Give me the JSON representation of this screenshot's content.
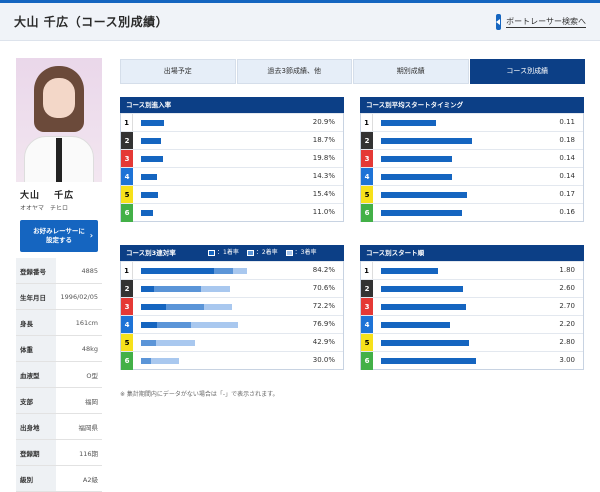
{
  "header": {
    "title": "大山 千広（コース別成績）",
    "back_link": "ボートレーサー検索へ"
  },
  "profile": {
    "name": "大山　 千広",
    "kana": "オオヤマ　チヒロ",
    "favorite_button": "お好みレーサーに\n設定する",
    "rows": [
      {
        "label": "登録番号",
        "value": "4885"
      },
      {
        "label": "生年月日",
        "value": "1996/02/05"
      },
      {
        "label": "身長",
        "value": "161cm"
      },
      {
        "label": "体重",
        "value": "48kg"
      },
      {
        "label": "血液型",
        "value": "O型"
      },
      {
        "label": "支部",
        "value": "福岡"
      },
      {
        "label": "出身地",
        "value": "福岡県"
      },
      {
        "label": "登録期",
        "value": "116期"
      },
      {
        "label": "級別",
        "value": "A2級"
      }
    ]
  },
  "tabs": [
    "出場予定",
    "過去3節成績、他",
    "期別成績",
    "コース別成績"
  ],
  "active_tab": 3,
  "colors": {
    "navy": "#0c3f86",
    "bar": "#1565c0",
    "bar2": "#5b95d8",
    "bar3": "#a9c8ef",
    "lane1_bg": "#ffffff",
    "lane1_fg": "#000000",
    "lane2_bg": "#333333",
    "lane2_fg": "#ffffff",
    "lane3_bg": "#e53935",
    "lane3_fg": "#ffffff",
    "lane4_bg": "#1e73d6",
    "lane4_fg": "#ffffff",
    "lane5_bg": "#f7e11a",
    "lane5_fg": "#000000",
    "lane6_bg": "#43b047",
    "lane6_fg": "#ffffff"
  },
  "panels": {
    "entry_rate": {
      "title": "コース別進入率",
      "scale_max": 100,
      "rows": [
        {
          "lane": "1",
          "value": 20.9,
          "label": "20.9%"
        },
        {
          "lane": "2",
          "value": 18.7,
          "label": "18.7%"
        },
        {
          "lane": "3",
          "value": 19.8,
          "label": "19.8%"
        },
        {
          "lane": "4",
          "value": 14.3,
          "label": "14.3%"
        },
        {
          "lane": "5",
          "value": 15.4,
          "label": "15.4%"
        },
        {
          "lane": "6",
          "value": 11.0,
          "label": "11.0%"
        }
      ]
    },
    "avg_start": {
      "title": "コース別平均スタートタイミング",
      "scale_max": 0.2,
      "rows": [
        {
          "lane": "1",
          "value": 0.11,
          "label": "0.11"
        },
        {
          "lane": "2",
          "value": 0.18,
          "label": "0.18"
        },
        {
          "lane": "3",
          "value": 0.14,
          "label": "0.14"
        },
        {
          "lane": "4",
          "value": 0.14,
          "label": "0.14"
        },
        {
          "lane": "5",
          "value": 0.17,
          "label": "0.17"
        },
        {
          "lane": "6",
          "value": 0.16,
          "label": "0.16"
        }
      ]
    },
    "top3_rate": {
      "title": "コース別3連対率",
      "legend": [
        "：1着率",
        "：2着率",
        "：3着率"
      ],
      "scale_max": 100,
      "rows": [
        {
          "lane": "1",
          "values": [
            58,
            15,
            11.2
          ],
          "label": "84.2%"
        },
        {
          "lane": "2",
          "values": [
            10,
            38,
            22.6
          ],
          "label": "70.6%"
        },
        {
          "lane": "3",
          "values": [
            20,
            30,
            22.2
          ],
          "label": "72.2%"
        },
        {
          "lane": "4",
          "values": [
            13,
            27,
            36.9
          ],
          "label": "76.9%"
        },
        {
          "lane": "5",
          "values": [
            0,
            12,
            30.9
          ],
          "label": "42.9%"
        },
        {
          "lane": "6",
          "values": [
            0,
            8,
            22.0
          ],
          "label": "30.0%"
        }
      ]
    },
    "avg_start_rank": {
      "title": "コース別スタート順",
      "scale_max": 3.2,
      "rows": [
        {
          "lane": "1",
          "value": 1.8,
          "label": "1.80"
        },
        {
          "lane": "2",
          "value": 2.6,
          "label": "2.60"
        },
        {
          "lane": "3",
          "value": 2.7,
          "label": "2.70"
        },
        {
          "lane": "4",
          "value": 2.2,
          "label": "2.20"
        },
        {
          "lane": "5",
          "value": 2.8,
          "label": "2.80"
        },
        {
          "lane": "6",
          "value": 3.0,
          "label": "3.00"
        }
      ]
    }
  },
  "note": "※ 集計期間内にデータがない場合は「-」で表示されます。"
}
